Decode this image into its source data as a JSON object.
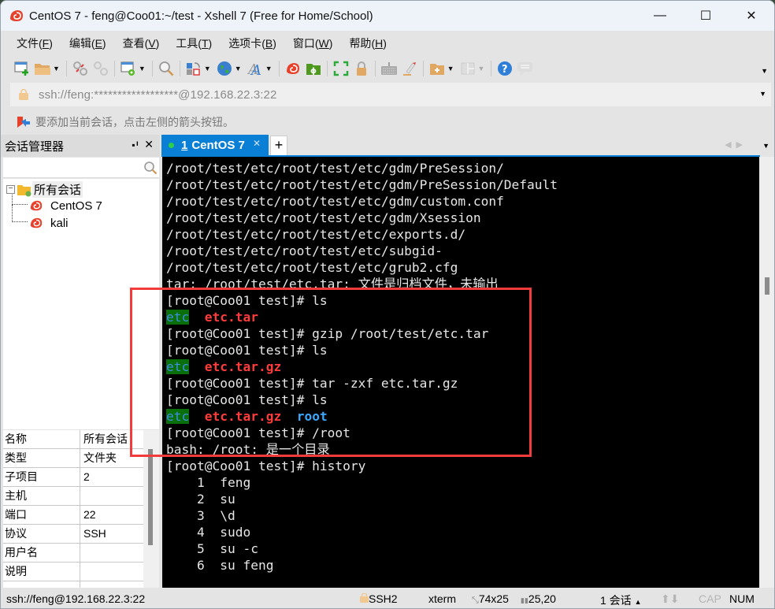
{
  "window": {
    "title": "CentOS 7 - feng@Coo01:~/test - Xshell 7 (Free for Home/School)",
    "controls": {
      "minimize": "—",
      "maximize": "☐",
      "close": "✕"
    }
  },
  "menu": [
    {
      "label": "文件",
      "key": "F"
    },
    {
      "label": "编辑",
      "key": "E"
    },
    {
      "label": "查看",
      "key": "V"
    },
    {
      "label": "工具",
      "key": "T"
    },
    {
      "label": "选项卡",
      "key": "B"
    },
    {
      "label": "窗口",
      "key": "W"
    },
    {
      "label": "帮助",
      "key": "H"
    }
  ],
  "toolbar": {
    "icons": [
      "new-session-icon",
      "open-folder-icon",
      "reconnect-icon",
      "disconnect-icon",
      "properties-icon",
      "find-icon",
      "transfer-icon",
      "globe-icon",
      "font-icon",
      "xshell-icon",
      "xftp-icon",
      "fullscreen-icon",
      "lock-icon",
      "keyboard-icon",
      "highlight-icon",
      "new-folder-icon",
      "layout-icon",
      "help-icon",
      "chat-icon"
    ]
  },
  "address": {
    "value": "ssh://feng:******************@192.168.22.3:22"
  },
  "hint": {
    "text": "要添加当前会话，点击左侧的箭头按钮。"
  },
  "session_manager": {
    "title": "会话管理器",
    "pin": "📌",
    "close": "✕",
    "search_placeholder": "",
    "tree": {
      "root": "所有会话",
      "children": [
        "CentOS 7",
        "kali"
      ]
    },
    "properties": [
      {
        "key": "名称",
        "value": "所有会话"
      },
      {
        "key": "类型",
        "value": "文件夹"
      },
      {
        "key": "子项目",
        "value": "2"
      },
      {
        "key": "主机",
        "value": ""
      },
      {
        "key": "端口",
        "value": "22"
      },
      {
        "key": "协议",
        "value": "SSH"
      },
      {
        "key": "用户名",
        "value": ""
      },
      {
        "key": "说明",
        "value": ""
      }
    ]
  },
  "tabs": {
    "active": {
      "number": "1",
      "label": "CentOS 7",
      "close": "✕",
      "status_color": "#2ed04a"
    },
    "add_label": "+"
  },
  "terminal": {
    "lines": [
      [
        {
          "t": "/root/test/etc/root/test/etc/gdm/PreSession/"
        }
      ],
      [
        {
          "t": "/root/test/etc/root/test/etc/gdm/PreSession/Default"
        }
      ],
      [
        {
          "t": "/root/test/etc/root/test/etc/gdm/custom.conf"
        }
      ],
      [
        {
          "t": "/root/test/etc/root/test/etc/gdm/Xsession"
        }
      ],
      [
        {
          "t": "/root/test/etc/root/test/etc/exports.d/"
        }
      ],
      [
        {
          "t": "/root/test/etc/root/test/etc/subgid-"
        }
      ],
      [
        {
          "t": "/root/test/etc/root/test/etc/grub2.cfg"
        }
      ],
      [
        {
          "t": "tar: /root/test/etc.tar: 文件是归档文件，未输出"
        }
      ],
      [
        {
          "t": "[root@Coo01 test]# ls"
        }
      ],
      [
        {
          "t": "etc",
          "c": "dir"
        },
        {
          "t": "  "
        },
        {
          "t": "etc.tar",
          "c": "red"
        }
      ],
      [
        {
          "t": "[root@Coo01 test]# gzip /root/test/etc.tar"
        }
      ],
      [
        {
          "t": "[root@Coo01 test]# ls"
        }
      ],
      [
        {
          "t": "etc",
          "c": "dir"
        },
        {
          "t": "  "
        },
        {
          "t": "etc.tar.gz",
          "c": "red"
        }
      ],
      [
        {
          "t": "[root@Coo01 test]# tar -zxf etc.tar.gz"
        }
      ],
      [
        {
          "t": "[root@Coo01 test]# ls"
        }
      ],
      [
        {
          "t": "etc",
          "c": "dir"
        },
        {
          "t": "  "
        },
        {
          "t": "etc.tar.gz",
          "c": "red"
        },
        {
          "t": "  "
        },
        {
          "t": "root",
          "c": "blue"
        }
      ],
      [
        {
          "t": "[root@Coo01 test]# /root"
        }
      ],
      [
        {
          "t": "bash: /root: 是一个目录"
        }
      ],
      [
        {
          "t": "[root@Coo01 test]# history"
        }
      ],
      [
        {
          "t": "    1  feng"
        }
      ],
      [
        {
          "t": "    2  su"
        }
      ],
      [
        {
          "t": "    3  \\d"
        }
      ],
      [
        {
          "t": "    4  sudo"
        }
      ],
      [
        {
          "t": "    5  su -c"
        }
      ],
      [
        {
          "t": "    6  su feng"
        }
      ]
    ],
    "colors": {
      "dir_bg": "#0a6e0a",
      "dir_fg": "#3b8fe0",
      "archive": "#ff3b3b",
      "folder": "#3ba8ff"
    },
    "annotation_color": "#f23c3c"
  },
  "statusbar": {
    "connection": "ssh://feng@192.168.22.3:22",
    "protocol": "SSH2",
    "term_type": "xterm",
    "size": "74x25",
    "cursor": "25,20",
    "sessions": "1 会话",
    "cap": "CAP",
    "num": "NUM"
  }
}
